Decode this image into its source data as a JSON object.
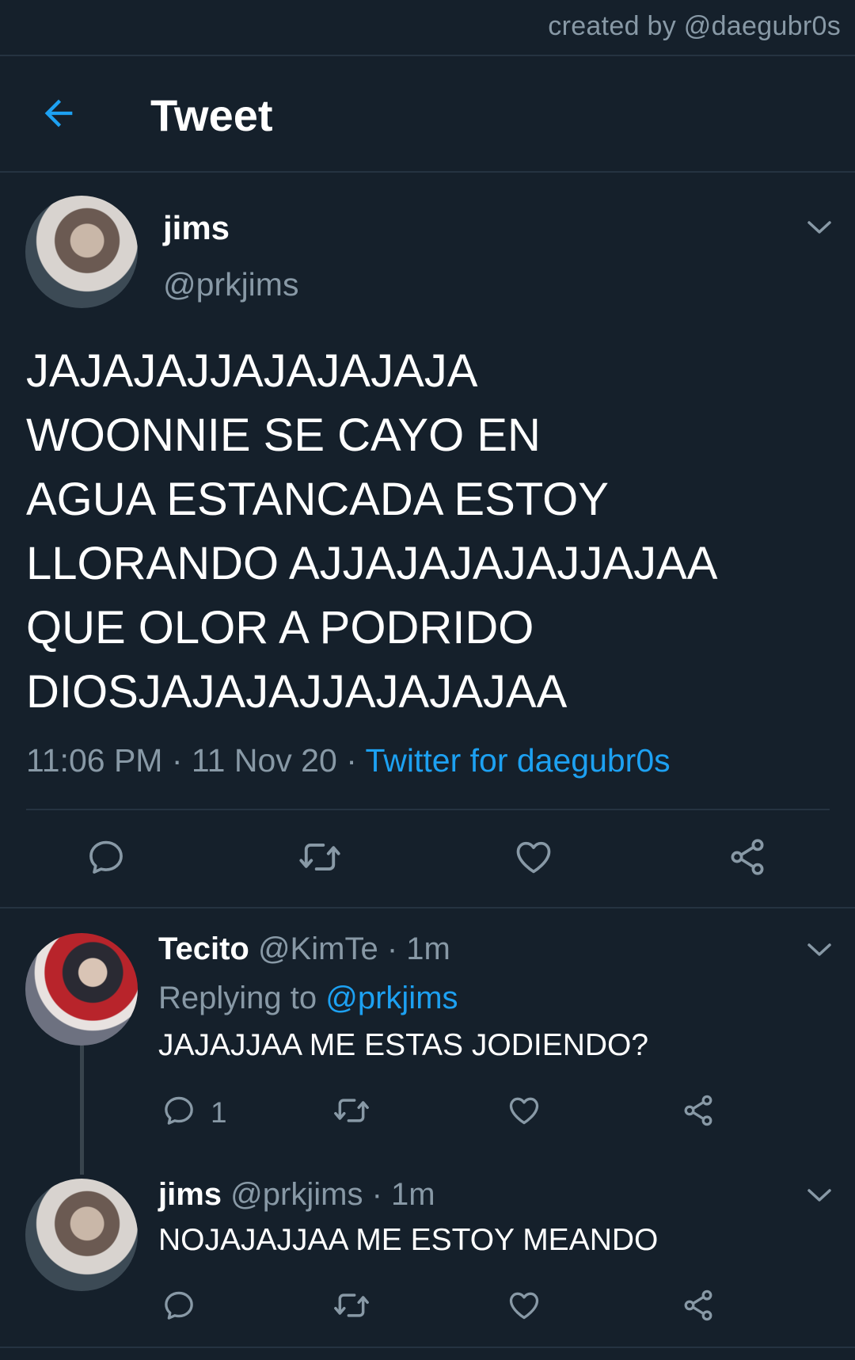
{
  "credit": "created by @daegubr0s",
  "header": {
    "title": "Tweet",
    "back_icon": "arrow-left-icon"
  },
  "main_tweet": {
    "name": "jims",
    "handle": "@prkjims",
    "text": "JAJAJAJJAJAJAJAJA\nWOONNIE SE CAYO EN\nAGUA ESTANCADA ESTOY\nLLORANDO AJJAJAJAJAJJAJAA\nQUE OLOR A PODRIDO\nDIOSJAJAJAJJAJAJAJAA",
    "time": "11:06 PM",
    "date": "11 Nov 20",
    "source": "Twitter for daegubr0s",
    "separator": "·"
  },
  "replies": [
    {
      "name": "Tecito",
      "handle": "@KimTe",
      "age": "1m",
      "replying_label": "Replying to",
      "replying_to": "@prkjims",
      "text": "JAJAJJAA ME ESTAS JODIENDO?",
      "reply_count": "1"
    },
    {
      "name": "jims",
      "handle": "@prkjims",
      "age": "1m",
      "text": "NOJAJAJJAA ME ESTOY MEANDO"
    }
  ],
  "colors": {
    "background": "#15202b",
    "accent": "#1da1f2",
    "muted": "#8899a6",
    "divider": "#253341"
  }
}
